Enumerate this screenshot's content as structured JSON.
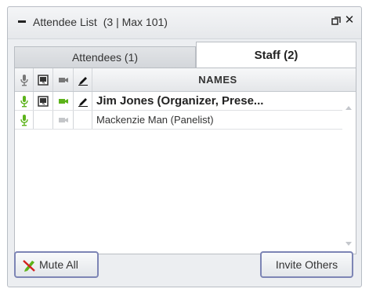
{
  "window": {
    "title": "Attendee List",
    "count": "(3 | Max 101)"
  },
  "tabs": [
    {
      "label": "Attendees (1)",
      "active": false
    },
    {
      "label": "Staff (2)",
      "active": true
    }
  ],
  "grid": {
    "columns": [
      "mic-icon",
      "screen-icon",
      "camera-icon",
      "pencil-icon"
    ],
    "names_header": "NAMES",
    "rows": [
      {
        "name": "Jim Jones (Organizer, Prese...",
        "mic": "green",
        "screen": true,
        "camera": "green",
        "pencil": true
      },
      {
        "name": "Mackenzie Man (Panelist)",
        "mic": "green",
        "screen": false,
        "camera": "grey",
        "pencil": false
      }
    ]
  },
  "buttons": {
    "mute_all": "Mute All",
    "invite_others": "Invite Others"
  },
  "colors": {
    "accent_green": "#5cb31a",
    "button_border": "#7d85b5",
    "panel_bg": "#eceef1"
  }
}
